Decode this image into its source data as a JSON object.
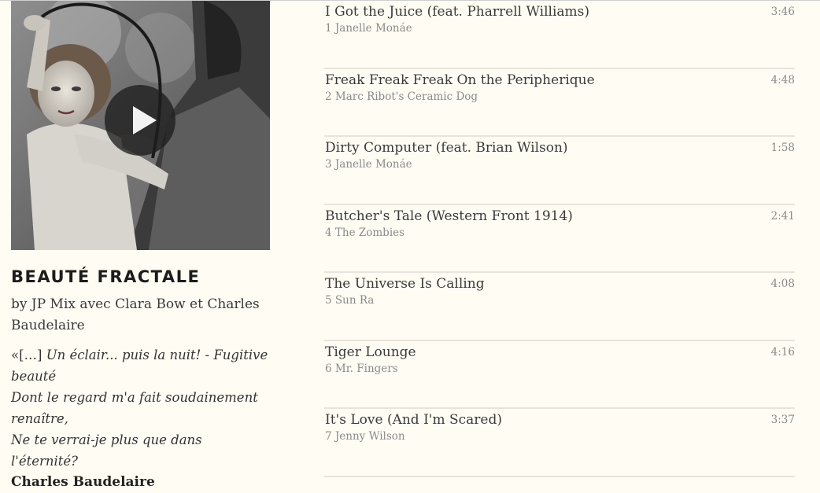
{
  "mix": {
    "title": "BEAUTÉ FRACTALE",
    "byline": "by JP Mix avec Clara Bow et Charles Baudelaire",
    "quote_open": "«[…] ",
    "quote_lines": [
      "Un éclair... puis la nuit! - Fugitive beauté",
      "Dont le regard m'a fait soudainement renaître,",
      "Ne te verrai-je plus que dans l'éternité?"
    ],
    "quote_author": "Charles Baudelaire"
  },
  "cover": {
    "play_icon": "play-icon"
  },
  "tracks": [
    {
      "title": "I Got the Juice (feat. Pharrell Williams)",
      "number": "1",
      "artist": "Janelle Monáe",
      "duration": "3:46"
    },
    {
      "title": "Freak Freak Freak On the Peripherique",
      "number": "2",
      "artist": "Marc Ribot's Ceramic Dog",
      "duration": "4:48"
    },
    {
      "title": "Dirty Computer (feat. Brian Wilson)",
      "number": "3",
      "artist": "Janelle Monáe",
      "duration": "1:58"
    },
    {
      "title": "Butcher's Tale (Western Front 1914)",
      "number": "4",
      "artist": "The Zombies",
      "duration": "2:41"
    },
    {
      "title": "The Universe Is Calling",
      "number": "5",
      "artist": "Sun Ra",
      "duration": "4:08"
    },
    {
      "title": "Tiger Lounge",
      "number": "6",
      "artist": "Mr. Fingers",
      "duration": "4:16"
    },
    {
      "title": "It's Love (And I'm Scared)",
      "number": "7",
      "artist": "Jenny Wilson",
      "duration": "3:37"
    }
  ]
}
